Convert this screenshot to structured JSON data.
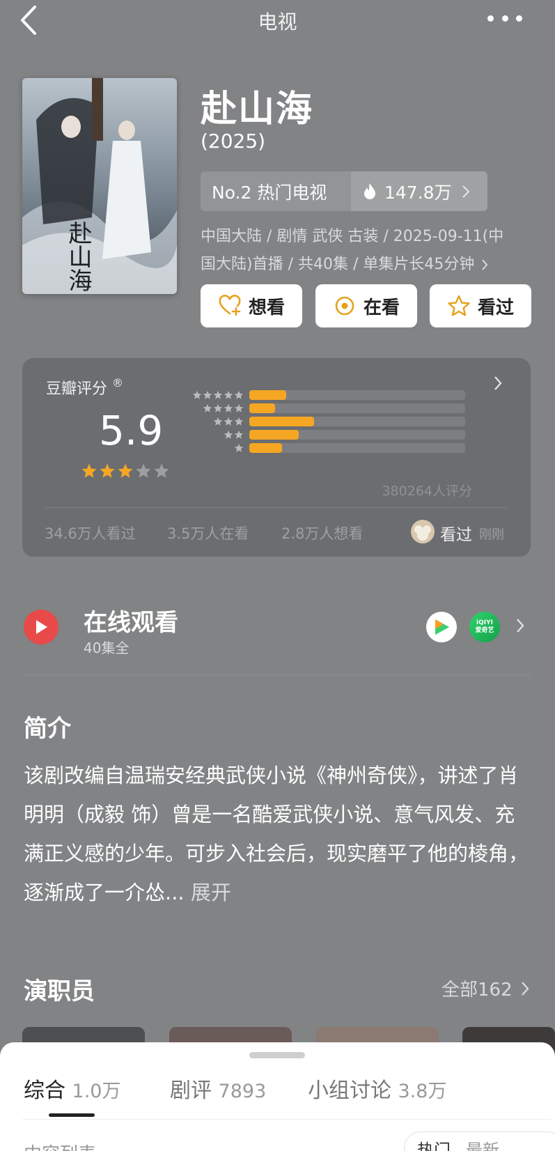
{
  "nav": {
    "title": "电视"
  },
  "show": {
    "title": "赴山海",
    "year": "(2025)",
    "rank_label": "No.2  热门电视",
    "heat": "147.8万",
    "meta_line1": "中国大陆 / 剧情  武侠  古装 / 2025-09-11(中",
    "meta_line2": "国大陆)首播 / 共40集 / 单集片长45分钟",
    "poster_text": "赴山海"
  },
  "actions": {
    "want": "想看",
    "watching": "在看",
    "watched": "看过"
  },
  "rating": {
    "label": "豆瓣评分",
    "score": "5.9",
    "star_value": 3,
    "distribution": [
      {
        "stars": 5,
        "fraction": 0.17
      },
      {
        "stars": 4,
        "fraction": 0.12
      },
      {
        "stars": 3,
        "fraction": 0.3
      },
      {
        "stars": 2,
        "fraction": 0.23
      },
      {
        "stars": 1,
        "fraction": 0.15
      }
    ],
    "count": "380264人评分",
    "stat_seen": "34.6万人看过",
    "stat_watching": "3.5万人在看",
    "stat_want": "2.8万人想看",
    "user_status": "看过",
    "user_time": "刚刚"
  },
  "online": {
    "title": "在线观看",
    "episodes": "40集全",
    "logo2_top": "iQIYI",
    "logo2_bottom": "爱奇艺"
  },
  "synopsis": {
    "title": "简介",
    "text": "该剧改编自温瑞安经典武侠小说《神州奇侠》，讲述了肖明明（成毅 饰）曾是一名酷爱武侠小说、意气风发、充满正义感的少年。可步入社会后，现实磨平了他的棱角，逐渐成了一介怂...",
    "expand": "展开"
  },
  "cast": {
    "title": "演职员",
    "all": "全部162"
  },
  "sheet": {
    "tabs": [
      {
        "label": "综合",
        "count": "1.0万"
      },
      {
        "label": "剧评",
        "count": "7893"
      },
      {
        "label": "小组讨论",
        "count": "3.8万"
      }
    ],
    "subtitle": "内容列表",
    "sort_hot": "热门",
    "sort_new": "最新"
  },
  "colors": {
    "background": "#818385",
    "accent_orange": "#f5a623",
    "play_red": "#e84a4a"
  }
}
